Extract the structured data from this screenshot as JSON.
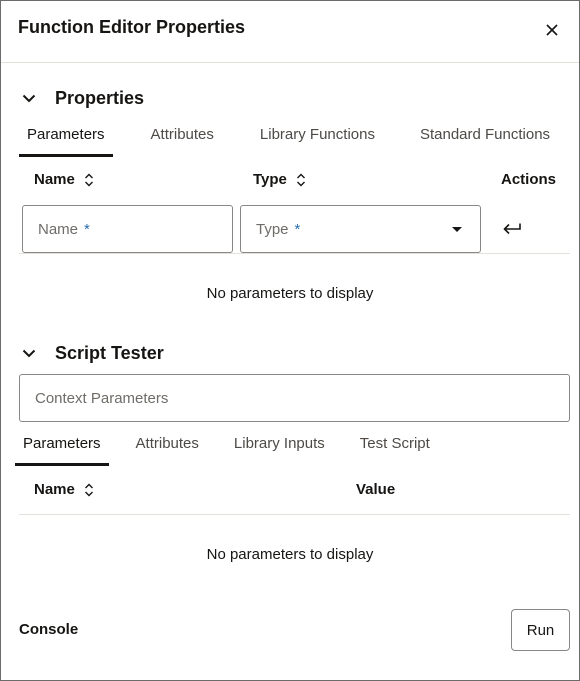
{
  "dialog": {
    "title": "Function Editor Properties",
    "close_icon": "close-icon"
  },
  "properties": {
    "title": "Properties",
    "tabs": [
      {
        "label": "Parameters",
        "active": true
      },
      {
        "label": "Attributes",
        "active": false
      },
      {
        "label": "Library Functions",
        "active": false
      },
      {
        "label": "Standard Functions",
        "active": false
      }
    ],
    "columns": {
      "name": "Name",
      "type": "Type",
      "actions": "Actions"
    },
    "name_placeholder": "Name",
    "type_placeholder": "Type",
    "required_mark": "*",
    "empty_message": "No parameters to display"
  },
  "script_tester": {
    "title": "Script Tester",
    "context_placeholder": "Context Parameters",
    "tabs": [
      {
        "label": "Parameters",
        "active": true
      },
      {
        "label": "Attributes",
        "active": false
      },
      {
        "label": "Library Inputs",
        "active": false
      },
      {
        "label": "Test Script",
        "active": false
      }
    ],
    "columns": {
      "name": "Name",
      "value": "Value"
    },
    "empty_message": "No parameters to display"
  },
  "footer": {
    "console_label": "Console",
    "run_label": "Run"
  }
}
